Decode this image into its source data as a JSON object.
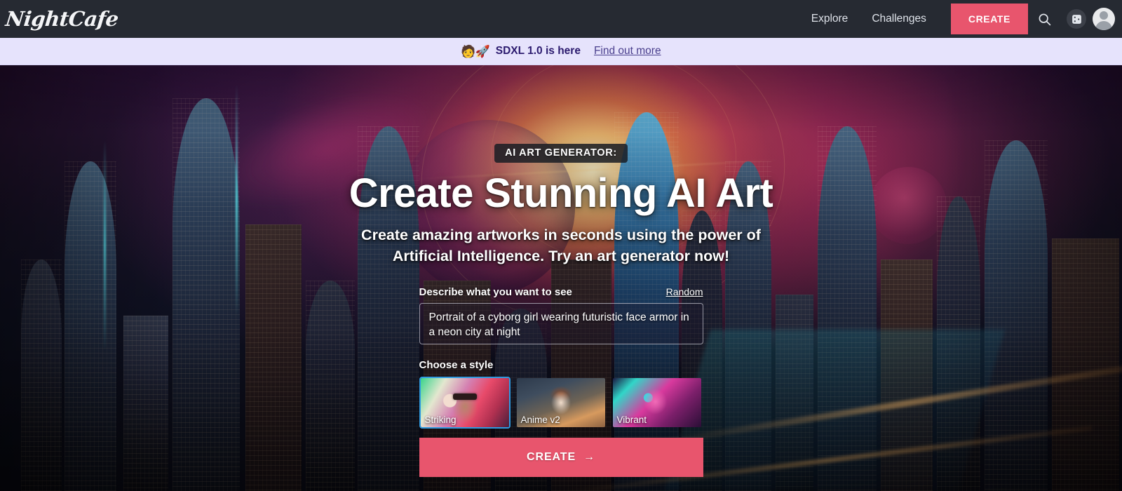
{
  "header": {
    "logo": "NightCafe",
    "nav": [
      {
        "label": "Explore",
        "name": "nav-explore"
      },
      {
        "label": "Challenges",
        "name": "nav-challenges"
      }
    ],
    "create_label": "CREATE",
    "icons": {
      "search": "search-icon",
      "dice": "dice-icon",
      "avatar": "avatar"
    }
  },
  "banner": {
    "emoji": "🧑🚀",
    "text": "SDXL 1.0 is here",
    "link": "Find out more"
  },
  "hero": {
    "eyebrow": "AI ART GENERATOR:",
    "title": "Create Stunning AI Art",
    "subtitle_line1": "Create amazing artworks in seconds using the power of",
    "subtitle_line2": "Artificial Intelligence. Try an art generator now!"
  },
  "form": {
    "prompt_label": "Describe what you want to see",
    "random_label": "Random",
    "prompt_value": "Portrait of a cyborg girl wearing futuristic face armor in a neon city at night",
    "prompt_placeholder": "Describe what you want to see",
    "styles_label": "Choose a style",
    "styles": [
      {
        "label": "Striking",
        "selected": true
      },
      {
        "label": "Anime v2",
        "selected": false
      },
      {
        "label": "Vibrant",
        "selected": false
      }
    ],
    "submit_label": "CREATE",
    "submit_arrow": "→"
  },
  "colors": {
    "header_bg": "#262a32",
    "banner_bg": "#e6e3fc",
    "banner_text": "#2b1a6e",
    "accent_pink": "#e8556d",
    "selected_border": "#2f9ae0"
  }
}
